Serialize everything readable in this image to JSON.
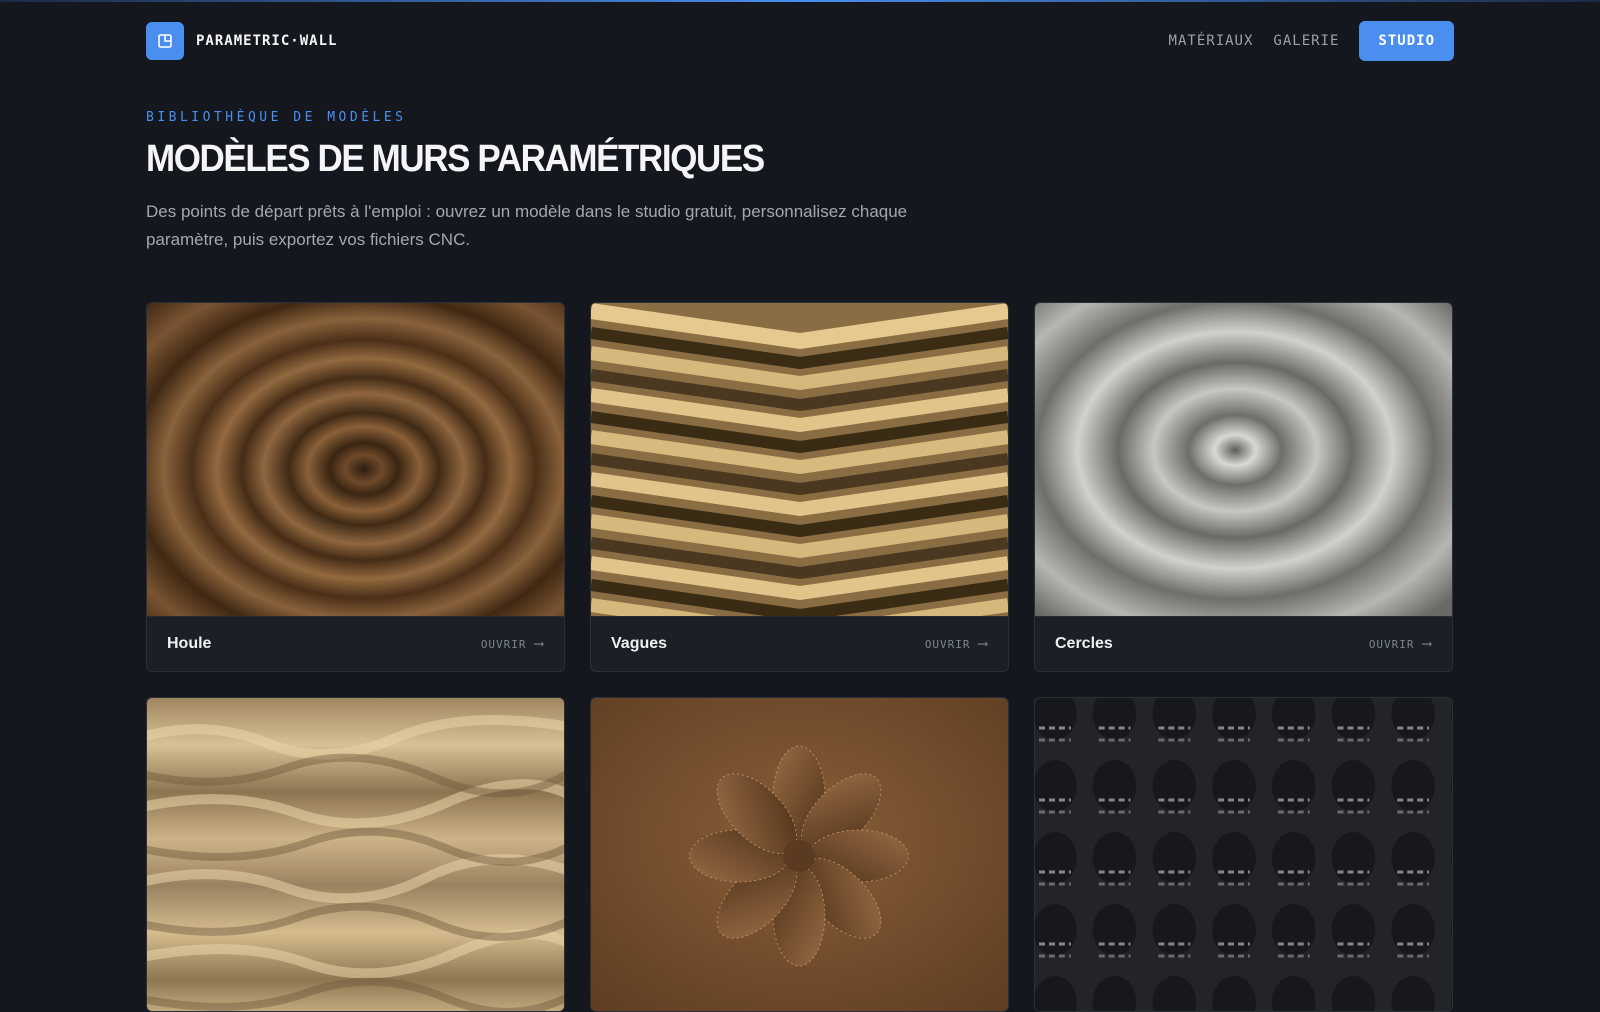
{
  "brand": {
    "name": "PARAMETRIC·WALL",
    "logo_icon": "panel-icon",
    "accent": "#4a8ff0"
  },
  "nav": {
    "links": [
      {
        "label": "MATÉRIAUX"
      },
      {
        "label": "GALERIE"
      }
    ],
    "cta_label": "STUDIO"
  },
  "hero": {
    "eyebrow": "BIBLIOTHÈQUE DE MODÈLES",
    "title": "MODÈLES DE MURS PARAMÉTRIQUES",
    "intro": "Des points de départ prêts à l'emploi : ouvrez un modèle dans le studio gratuit, personnalisez chaque paramètre, puis exportez vos fichiers CNC."
  },
  "templates": [
    {
      "title": "Houle",
      "open_label": "OUVRIR",
      "arrow_icon": "arrow-right-icon",
      "material_color": "#7a5434"
    },
    {
      "title": "Vagues",
      "open_label": "OUVRIR",
      "arrow_icon": "arrow-right-icon",
      "material_color": "#b89562"
    },
    {
      "title": "Cercles",
      "open_label": "OUVRIR",
      "arrow_icon": "arrow-right-icon",
      "material_color": "#a8a6a2"
    },
    {
      "material_color": "#b8a078"
    },
    {
      "material_color": "#704a2c"
    },
    {
      "material_color": "#3a3b3e"
    }
  ]
}
